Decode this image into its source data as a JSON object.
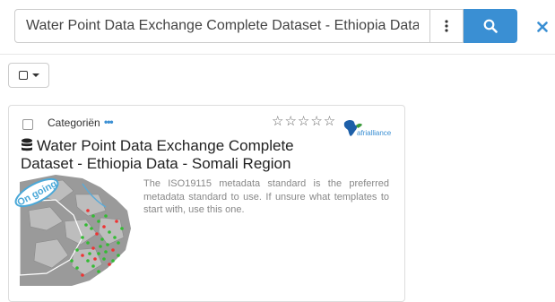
{
  "search": {
    "value": "Water Point Data Exchange Complete Dataset - Ethiopia Data - Somali Region",
    "placeholder": "",
    "more_icon": "vertical-dots-icon",
    "search_icon": "magnifier-icon",
    "clear_icon": "close-icon"
  },
  "selection": {
    "dropdown_icon": "checkbox-square-icon"
  },
  "result": {
    "categories_label": "Categoriën",
    "categories_more": "•••",
    "stars": "☆☆☆☆☆",
    "rating": 0,
    "organisation_logo_text": "afrialliance",
    "title": "Water Point Data Exchange Complete Dataset - Ethiopia Data - Somali Region",
    "status_badge": "On going",
    "abstract": "The ISO19115 metadata standard is the preferred metadata standard to use. If unsure what templates to start with, use this one."
  },
  "colors": {
    "accent": "#3a8fd3",
    "badge": "#4aa8d8"
  }
}
